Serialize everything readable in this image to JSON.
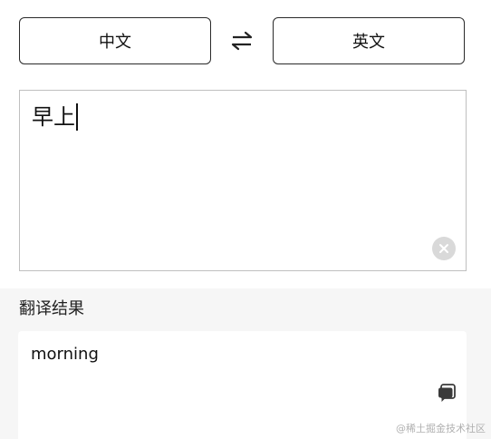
{
  "languages": {
    "source": "中文",
    "target": "英文",
    "swap_icon": "swap-arrows-icon"
  },
  "input": {
    "text": "早上",
    "clear_icon": "clear-icon"
  },
  "result": {
    "label": "翻译结果",
    "text": "morning",
    "copy_icon": "copy-icon"
  },
  "watermark": "@稀土掘金技术社区",
  "colors": {
    "background": "#f6f6f6",
    "surface": "#ffffff",
    "border": "#2a2a2a",
    "input_border": "#bfbfbf",
    "clear_button": "#d9d9d9"
  }
}
